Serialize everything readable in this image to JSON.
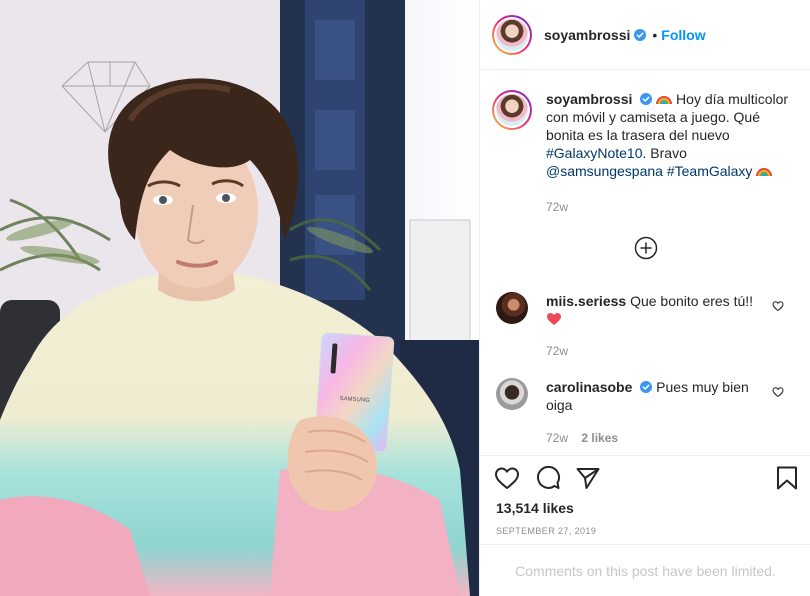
{
  "post": {
    "username": "soyambrossi",
    "follow_label": "Follow",
    "dot": "•"
  },
  "caption": {
    "username": "soyambrossi",
    "text_1": "Hoy día multicolor con móvil y camiseta a juego. Qué bonita es la trasera del nuevo",
    "hashtag_1": "#GalaxyNote10",
    "text_2": ". Bravo",
    "mention": "@samsungespana",
    "hashtag_2": "#TeamGalaxy",
    "time": "72w"
  },
  "comments": [
    {
      "username": "miis.seriess",
      "text": "Que bonito eres tú!!",
      "time": "72w"
    },
    {
      "username": "carolinasobe",
      "text": "Pues muy bien oiga",
      "time": "72w",
      "likes": "2 likes"
    }
  ],
  "stats": {
    "likes": "13,514 likes",
    "date": "September 27, 2019"
  },
  "footer": {
    "limited_text": "Comments on this post have been limited."
  },
  "photo": {
    "phone_brand": "SAMSUNG"
  },
  "icons": {
    "verified": "verified-badge-icon",
    "like": "heart-icon",
    "comment": "comment-icon",
    "share": "paper-plane-icon",
    "save": "bookmark-icon",
    "load_more": "plus-circle-icon"
  },
  "colors": {
    "link_blue": "#0095f6",
    "hashtag": "#00376b",
    "meta_gray": "#8e8e8e",
    "text": "#262626",
    "heart_red": "#ed4956"
  }
}
